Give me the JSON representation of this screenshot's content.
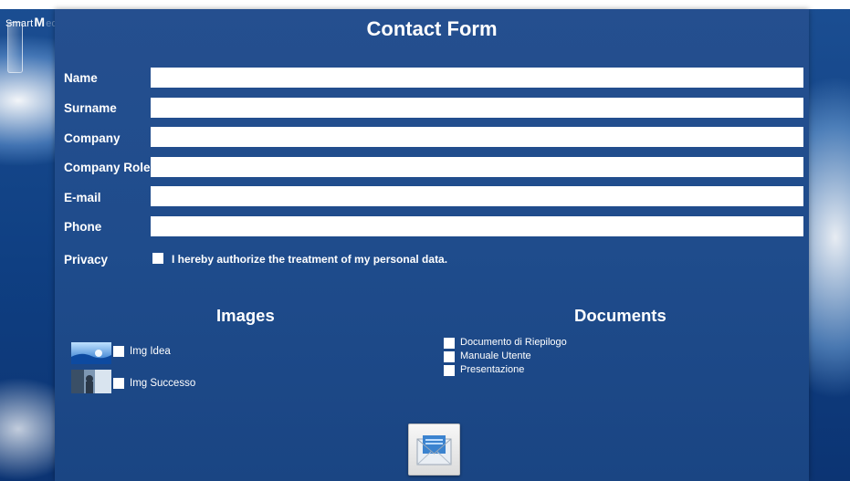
{
  "brand": {
    "s": "S",
    "mart": "mart",
    "m": "M",
    "edia": "edia"
  },
  "form": {
    "title": "Contact Form",
    "fields": [
      {
        "label": "Name",
        "value": ""
      },
      {
        "label": "Surname",
        "value": ""
      },
      {
        "label": "Company",
        "value": ""
      },
      {
        "label": "Company Role",
        "value": ""
      },
      {
        "label": "E-mail",
        "value": ""
      },
      {
        "label": "Phone",
        "value": ""
      }
    ],
    "privacy": {
      "label": "Privacy",
      "text": "I hereby authorize the treatment of my personal data.",
      "checked": false
    }
  },
  "images": {
    "title": "Images",
    "items": [
      {
        "label": "Img Idea",
        "checked": false,
        "icon": "idea-thumbnail-icon"
      },
      {
        "label": "Img Successo",
        "checked": false,
        "icon": "success-thumbnail-icon"
      }
    ]
  },
  "documents": {
    "title": "Documents",
    "items": [
      {
        "label": "Documento di Riepilogo",
        "checked": false
      },
      {
        "label": "Manuale Utente",
        "checked": false
      },
      {
        "label": "Presentazione",
        "checked": false
      }
    ]
  },
  "send": {
    "icon": "envelope-icon"
  },
  "colors": {
    "panel": "#1f4c8c",
    "text": "#ffffff",
    "field": "#ffffff"
  }
}
